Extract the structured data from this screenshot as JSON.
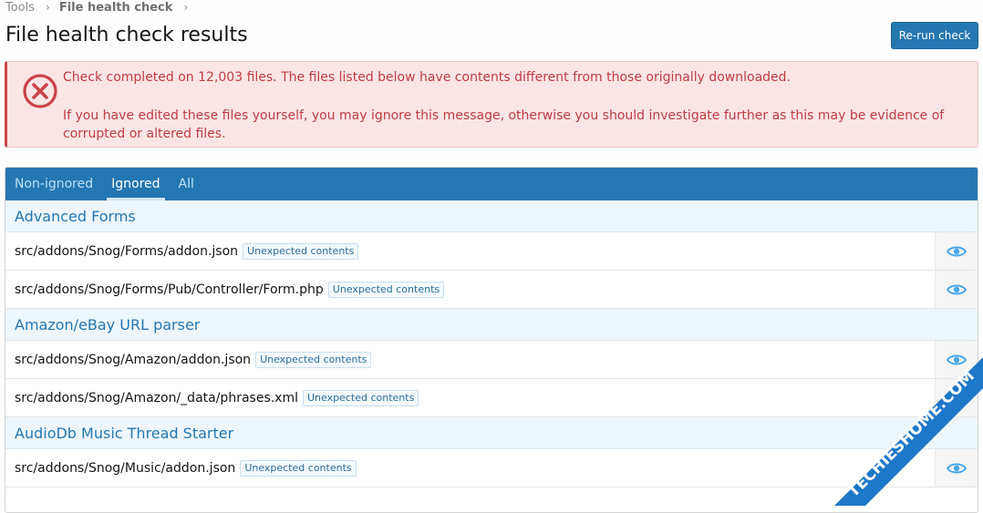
{
  "breadcrumb": {
    "root": "Tools",
    "current": "File health check"
  },
  "page": {
    "title": "File health check results",
    "rerun_label": "Re-run check"
  },
  "alert": {
    "line1": "Check completed on 12,003 files. The files listed below have contents different from those originally downloaded.",
    "line2": "If you have edited these files yourself, you may ignore this message, otherwise you should investigate further as this may be evidence of corrupted or altered files."
  },
  "tabs": [
    {
      "label": "Non-ignored"
    },
    {
      "label": "Ignored"
    },
    {
      "label": "All"
    }
  ],
  "groups": [
    {
      "title": "Advanced Forms",
      "files": [
        {
          "path": "src/addons/Snog/Forms/addon.json",
          "badge": "Unexpected contents"
        },
        {
          "path": "src/addons/Snog/Forms/Pub/Controller/Form.php",
          "badge": "Unexpected contents"
        }
      ]
    },
    {
      "title": "Amazon/eBay URL parser",
      "files": [
        {
          "path": "src/addons/Snog/Amazon/addon.json",
          "badge": "Unexpected contents"
        },
        {
          "path": "src/addons/Snog/Amazon/_data/phrases.xml",
          "badge": "Unexpected contents"
        }
      ]
    },
    {
      "title": "AudioDb Music Thread Starter",
      "files": [
        {
          "path": "src/addons/Snog/Music/addon.json",
          "badge": "Unexpected contents"
        }
      ]
    }
  ],
  "watermark": {
    "text": "TECHIESHOME.COM"
  },
  "colors": {
    "accent": "#2577b1",
    "error": "#c84448",
    "error_bg": "#fce5e5",
    "group_bg": "#edf6fd"
  }
}
